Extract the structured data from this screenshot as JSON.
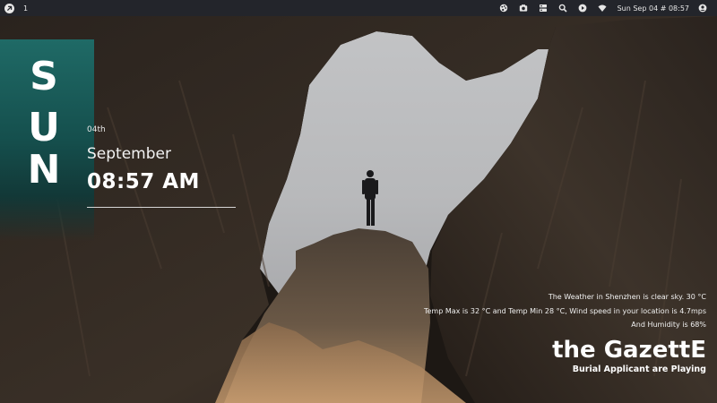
{
  "topbar": {
    "workspace_number": "1",
    "clock": "Sun Sep 04 # 08:57",
    "icons": [
      "app-logo-icon",
      "palette-icon",
      "camera-icon",
      "storage-icon",
      "search-icon",
      "play-icon",
      "wifi-icon",
      "user-icon"
    ]
  },
  "day_panel": {
    "letters": [
      "S",
      "U",
      "N"
    ],
    "accent_color": "#1f6a66"
  },
  "date_widget": {
    "day_of_month": "04th",
    "month": "September",
    "time": "08:57 AM"
  },
  "weather": {
    "line1": "The Weather in Shenzhen is clear sky. 30 °C",
    "line2": "Temp Max is 32 °C and Temp Min 28 °C, Wind speed in your location is 4.7mps",
    "line3": "And Humidity is 68%"
  },
  "music": {
    "artist": "the GazettE",
    "now_playing": "Burial Applicant are Playing"
  }
}
